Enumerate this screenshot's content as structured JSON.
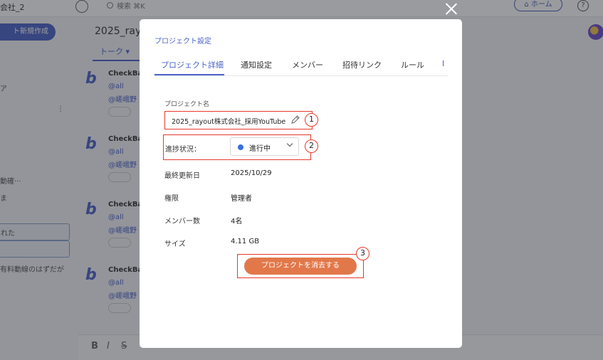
{
  "background": {
    "company": "会社_2",
    "search_placeholder": "検索 ⌘K",
    "home_button": "ホーム",
    "help": "?",
    "new_project_button": "ト新規作成",
    "project_title": "2025_rayo",
    "talk_tab": "トーク ▾",
    "sidebar_texts": [
      "ア",
      "⋮",
      "動確···",
      "ま",
      "れた",
      "有料動線のはずだが"
    ],
    "messages": [
      {
        "name": "CheckBa",
        "mention": "@all",
        "user": "@嵯峨野"
      },
      {
        "name": "CheckBa",
        "mention": "@all",
        "user": "@嵯峨野"
      },
      {
        "name": "CheckBa",
        "mention": "@all",
        "user": "@嵯峨野"
      },
      {
        "name": "CheckBa",
        "mention": "@all",
        "user": "@嵯峨野"
      }
    ],
    "toolbar": [
      "B",
      "I",
      "S"
    ]
  },
  "modal": {
    "title": "プロジェクト設定",
    "tabs": [
      {
        "label": "プロジェクト詳細",
        "active": true
      },
      {
        "label": "通知設定",
        "active": false
      },
      {
        "label": "メンバー",
        "active": false
      },
      {
        "label": "招待リンク",
        "active": false
      },
      {
        "label": "ルール",
        "active": false
      }
    ],
    "project_name_label": "プロジェクト名",
    "project_name_value": "2025_rayout株式会社_採用YouTube",
    "status_label": "進捗状況：",
    "status_value": "進行中",
    "status_color": "#3a6fe0",
    "info": [
      {
        "label": "最終更新日",
        "value": "2025/10/29"
      },
      {
        "label": "権限",
        "value": "管理者"
      },
      {
        "label": "メンバー数",
        "value": "4名"
      },
      {
        "label": "サイズ",
        "value": "4.11 GB"
      }
    ],
    "delete_button": "プロジェクトを消去する",
    "delete_color": "#e2784a",
    "callouts": [
      "1",
      "2",
      "3"
    ]
  }
}
